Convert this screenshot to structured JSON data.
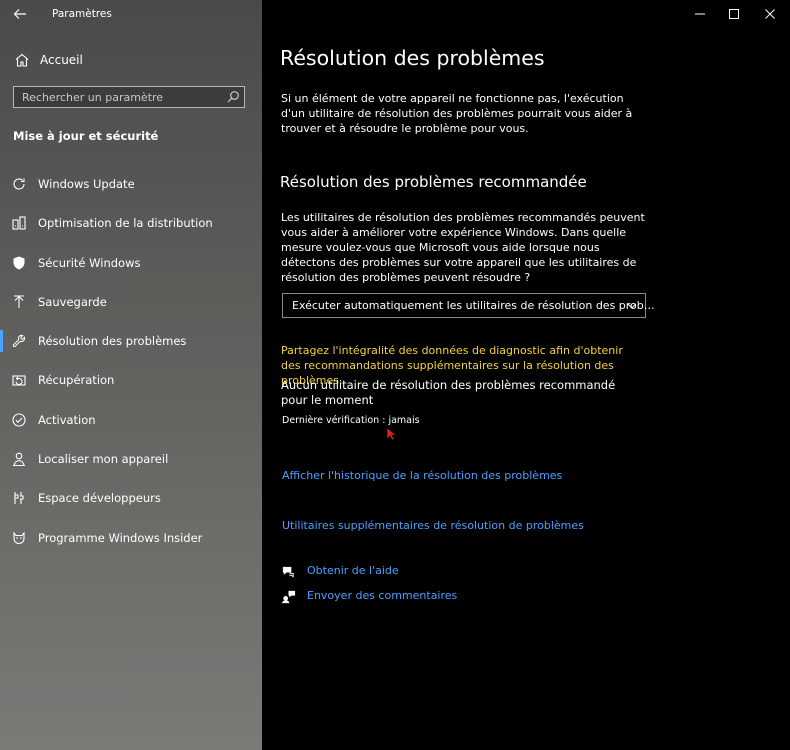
{
  "window": {
    "title": "Paramètres",
    "controls": [
      "minimize-icon",
      "maximize-icon",
      "close-icon"
    ]
  },
  "sidebar": {
    "home_label": "Accueil",
    "search": {
      "placeholder": "Rechercher un paramètre",
      "icon": "search-icon"
    },
    "section_title": "Mise à jour et sécurité",
    "items": [
      {
        "label": "Windows Update",
        "icon": "refresh-icon"
      },
      {
        "label": "Optimisation de la distribution",
        "icon": "delivery-icon"
      },
      {
        "label": "Sécurité Windows",
        "icon": "shield-icon"
      },
      {
        "label": "Sauvegarde",
        "icon": "backup-arrow-icon"
      },
      {
        "label": "Résolution des problèmes",
        "icon": "wrench-icon",
        "active": true
      },
      {
        "label": "Récupération",
        "icon": "recovery-icon"
      },
      {
        "label": "Activation",
        "icon": "check-circle-icon"
      },
      {
        "label": "Localiser mon appareil",
        "icon": "find-device-icon"
      },
      {
        "label": "Espace développeurs",
        "icon": "developer-icon"
      },
      {
        "label": "Programme Windows Insider",
        "icon": "insider-cat-icon"
      }
    ]
  },
  "main": {
    "title": "Résolution des problèmes",
    "intro": "Si un élément de votre appareil ne fonctionne pas, l'exécution d'un utilitaire de résolution des problèmes pourrait vous aider à trouver et à résoudre le problème pour vous.",
    "recommended": {
      "heading": "Résolution des problèmes recommandée",
      "description": "Les utilitaires de résolution des problèmes recommandés peuvent vous aider à améliorer votre expérience Windows. Dans quelle mesure voulez-vous que Microsoft vous aide lorsque nous détectons des problèmes sur votre appareil que les utilitaires de résolution des problèmes peuvent résoudre ?",
      "dropdown_value": "Exécuter automatiquement les utilitaires de résolution des prob…",
      "diagnostic_warning": "Partagez l'intégralité des données de diagnostic afin d'obtenir des recommandations supplémentaires sur la résolution des problèmes.",
      "none_text": "Aucun utilitaire de résolution des problèmes recommandé pour le moment",
      "last_check": "Dernière vérification : jamais"
    },
    "links": {
      "history": "Afficher l'historique de la résolution des problèmes",
      "additional": "Utilitaires supplémentaires de résolution de problèmes"
    },
    "help": [
      {
        "label": "Obtenir de l'aide",
        "icon": "help-chat-icon"
      },
      {
        "label": "Envoyer des commentaires",
        "icon": "feedback-icon"
      }
    ]
  },
  "colors": {
    "accent_link": "#4aa0ff",
    "warning_yellow": "#f6d33c",
    "active_indicator": "#4aa3ff"
  }
}
